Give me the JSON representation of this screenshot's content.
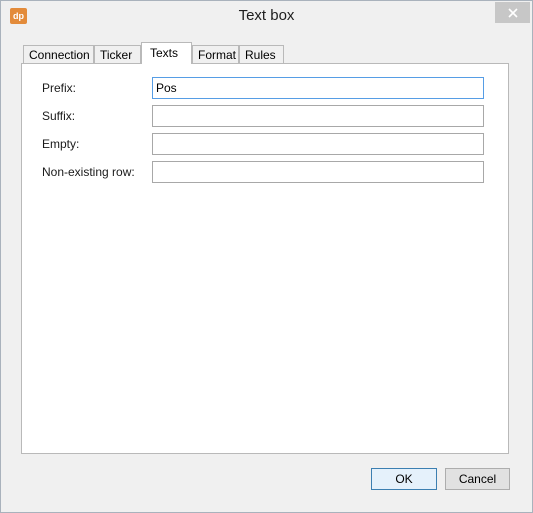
{
  "window": {
    "app_icon_text": "dp",
    "title": "Text box"
  },
  "tabs": [
    {
      "label": "Connection",
      "active": false
    },
    {
      "label": "Ticker",
      "active": false
    },
    {
      "label": "Texts",
      "active": true
    },
    {
      "label": "Format",
      "active": false
    },
    {
      "label": "Rules",
      "active": false
    }
  ],
  "fields": {
    "prefix": {
      "label": "Prefix:",
      "value": "Pos"
    },
    "suffix": {
      "label": "Suffix:",
      "value": ""
    },
    "empty": {
      "label": "Empty:",
      "value": ""
    },
    "non_existing_row": {
      "label": "Non-existing row:",
      "value": ""
    }
  },
  "buttons": {
    "ok": "OK",
    "cancel": "Cancel"
  },
  "colors": {
    "app_icon": "#e38b3a",
    "focus_border": "#569de5",
    "default_button_border": "#3c7fb1"
  },
  "icons": {
    "close": "close-icon",
    "app": "app-icon"
  }
}
